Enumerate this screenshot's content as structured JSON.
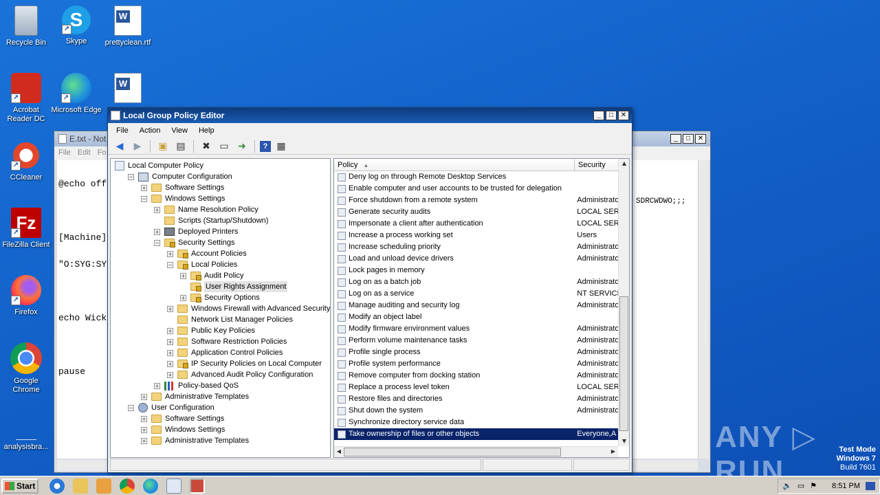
{
  "desktop": {
    "icons": [
      {
        "label": "Recycle Bin"
      },
      {
        "label": "Skype"
      },
      {
        "label": "prettyclean.rtf"
      },
      {
        "label": "Acrobat Reader DC"
      },
      {
        "label": "Microsoft Edge"
      },
      {
        "label": "CCleaner"
      },
      {
        "label": "FileZilla Client"
      },
      {
        "label": "Firefox"
      },
      {
        "label": "Google Chrome"
      },
      {
        "label": "analysisbra..."
      }
    ]
  },
  "notepad": {
    "title": "E.txt - Not",
    "menu": [
      "File",
      "Edit",
      "Fo"
    ],
    "lines": [
      "@echo off",
      "",
      "[Machine]",
      "\"O:SYG:SY",
      "",
      "echo Wick",
      "",
      "pause"
    ],
    "overflow_text": "SDRCWDWO;;;",
    "buttons": [
      "_",
      "□",
      "✕"
    ]
  },
  "gpo": {
    "title": "Local Group Policy Editor",
    "title_buttons": [
      "_",
      "□",
      "✕"
    ],
    "menu": [
      "File",
      "Action",
      "View",
      "Help"
    ],
    "tree": [
      {
        "label": "Local Computer Policy",
        "toggle": "",
        "icon": "policy",
        "level": 0
      },
      {
        "label": "Computer Configuration",
        "toggle": "−",
        "icon": "computer",
        "level": 1
      },
      {
        "label": "Software Settings",
        "toggle": "+",
        "icon": "folder",
        "level": 2
      },
      {
        "label": "Windows Settings",
        "toggle": "−",
        "icon": "folder",
        "level": 2
      },
      {
        "label": "Name Resolution Policy",
        "toggle": "+",
        "icon": "folder",
        "level": 3
      },
      {
        "label": "Scripts (Startup/Shutdown)",
        "toggle": "",
        "icon": "folder",
        "level": 3
      },
      {
        "label": "Deployed Printers",
        "toggle": "+",
        "icon": "printer",
        "level": 3
      },
      {
        "label": "Security Settings",
        "toggle": "−",
        "icon": "folder-lock",
        "level": 3
      },
      {
        "label": "Account Policies",
        "toggle": "+",
        "icon": "folder-lock",
        "level": 4
      },
      {
        "label": "Local Policies",
        "toggle": "−",
        "icon": "folder-lock",
        "level": 4
      },
      {
        "label": "Audit Policy",
        "toggle": "+",
        "icon": "folder-lock",
        "level": 5
      },
      {
        "label": "User Rights Assignment",
        "toggle": "",
        "icon": "folder-lock",
        "level": 5,
        "selected": true
      },
      {
        "label": "Security Options",
        "toggle": "+",
        "icon": "folder-lock",
        "level": 5
      },
      {
        "label": "Windows Firewall with Advanced Security",
        "toggle": "+",
        "icon": "folder",
        "level": 4
      },
      {
        "label": "Network List Manager Policies",
        "toggle": "",
        "icon": "folder",
        "level": 4
      },
      {
        "label": "Public Key Policies",
        "toggle": "+",
        "icon": "folder",
        "level": 4
      },
      {
        "label": "Software Restriction Policies",
        "toggle": "+",
        "icon": "folder",
        "level": 4
      },
      {
        "label": "Application Control Policies",
        "toggle": "+",
        "icon": "folder",
        "level": 4
      },
      {
        "label": "IP Security Policies on Local Computer",
        "toggle": "+",
        "icon": "folder-lock",
        "level": 4
      },
      {
        "label": "Advanced Audit Policy Configuration",
        "toggle": "+",
        "icon": "folder",
        "level": 4
      },
      {
        "label": "Policy-based QoS",
        "toggle": "+",
        "icon": "bars",
        "level": 3
      },
      {
        "label": "Administrative Templates",
        "toggle": "+",
        "icon": "folder",
        "level": 2
      },
      {
        "label": "User Configuration",
        "toggle": "−",
        "icon": "user",
        "level": 1
      },
      {
        "label": "Software Settings",
        "toggle": "+",
        "icon": "folder",
        "level": 2
      },
      {
        "label": "Windows Settings",
        "toggle": "+",
        "icon": "folder",
        "level": 2
      },
      {
        "label": "Administrative Templates",
        "toggle": "+",
        "icon": "folder",
        "level": 2
      }
    ],
    "list": {
      "columns": [
        "Policy",
        "Security Setti"
      ],
      "rows": [
        {
          "policy": "Deny log on through Remote Desktop Services",
          "setting": ""
        },
        {
          "policy": "Enable computer and user accounts to be trusted for delegation",
          "setting": ""
        },
        {
          "policy": "Force shutdown from a remote system",
          "setting": "Administrato"
        },
        {
          "policy": "Generate security audits",
          "setting": "LOCAL SERV"
        },
        {
          "policy": "Impersonate a client after authentication",
          "setting": "LOCAL SERV"
        },
        {
          "policy": "Increase a process working set",
          "setting": "Users"
        },
        {
          "policy": "Increase scheduling priority",
          "setting": "Administrato"
        },
        {
          "policy": "Load and unload device drivers",
          "setting": "Administrato"
        },
        {
          "policy": "Lock pages in memory",
          "setting": ""
        },
        {
          "policy": "Log on as a batch job",
          "setting": "Administrato"
        },
        {
          "policy": "Log on as a service",
          "setting": "NT SERVICE\\"
        },
        {
          "policy": "Manage auditing and security log",
          "setting": "Administrato"
        },
        {
          "policy": "Modify an object label",
          "setting": ""
        },
        {
          "policy": "Modify firmware environment values",
          "setting": "Administrato"
        },
        {
          "policy": "Perform volume maintenance tasks",
          "setting": "Administrato"
        },
        {
          "policy": "Profile single process",
          "setting": "Administrato"
        },
        {
          "policy": "Profile system performance",
          "setting": "Administrato"
        },
        {
          "policy": "Remove computer from docking station",
          "setting": "Administrato"
        },
        {
          "policy": "Replace a process level token",
          "setting": "LOCAL SERV"
        },
        {
          "policy": "Restore files and directories",
          "setting": "Administrato"
        },
        {
          "policy": "Shut down the system",
          "setting": "Administrato"
        },
        {
          "policy": "Synchronize directory service data",
          "setting": ""
        },
        {
          "policy": "Take ownership of files or other objects",
          "setting": "Everyone,A",
          "selected": true
        }
      ]
    }
  },
  "taskbar": {
    "start_label": "Start",
    "clock": "8:51 PM"
  },
  "watermark": {
    "brand": "ANY ▷ RUN",
    "line1": "Test Mode",
    "line2": "Windows 7",
    "line3": "Build 7601"
  }
}
